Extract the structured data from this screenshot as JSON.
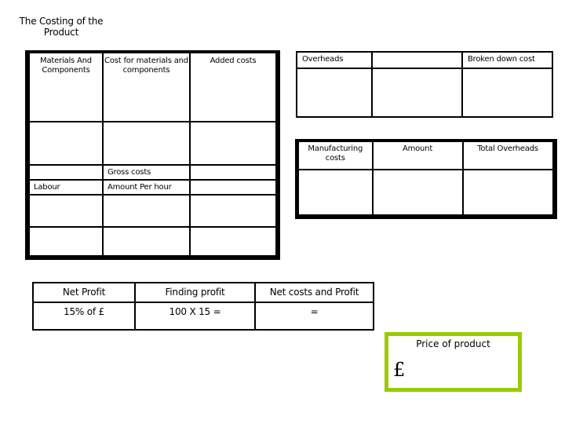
{
  "title": "The Costing of the Product",
  "materials_table": {
    "headers": [
      "Materials And Components",
      "Cost for materials and components",
      "Added costs"
    ],
    "gross_costs_label": "Gross costs",
    "labour_label": "Labour",
    "amount_per_hour_label": "Amount Per hour"
  },
  "overheads_table": {
    "headers": [
      "Overheads",
      "",
      "Broken down cost"
    ]
  },
  "manufacturing_table": {
    "headers": [
      "Manufacturing costs",
      "Amount",
      "Total Overheads"
    ]
  },
  "profit_table": {
    "headers": [
      "Net Profit",
      "Finding profit",
      "Net costs and Profit"
    ],
    "values": [
      "15% of £",
      "100 X 15 =",
      "="
    ]
  },
  "price_box": {
    "label": "Price of product",
    "currency_symbol": "£",
    "border_color": "#99cc00"
  }
}
